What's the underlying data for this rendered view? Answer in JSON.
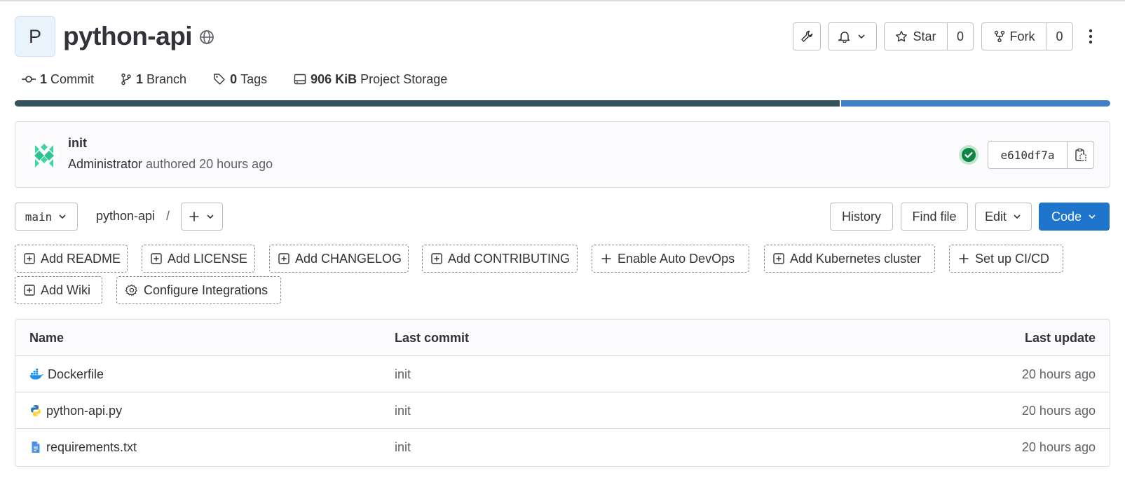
{
  "project": {
    "avatar_letter": "P",
    "name": "python-api",
    "visibility_icon": "globe-icon"
  },
  "header_actions": {
    "settings_icon": "wrench-icon",
    "notifications_icon": "bell-icon",
    "star_label": "Star",
    "star_count": "0",
    "fork_label": "Fork",
    "fork_count": "0",
    "more_icon": "kebab-vertical-icon"
  },
  "stats": {
    "commits_count": "1",
    "commits_label": "Commit",
    "branches_count": "1",
    "branches_label": "Branch",
    "tags_count": "0",
    "tags_label": "Tags",
    "storage_size": "906 KiB",
    "storage_label": "Project Storage"
  },
  "storage_usage": {
    "segments": [
      {
        "fraction": 0.753,
        "color": "#35535d"
      },
      {
        "fraction": 0.247,
        "color": "#3f7fc8"
      }
    ]
  },
  "last_commit": {
    "title": "init",
    "author": "Administrator",
    "authored_text": "authored 20 hours ago",
    "pipeline_status": "success",
    "status_color": "#108548",
    "sha": "e610df7a",
    "copy_icon": "copy-to-clipboard-icon"
  },
  "nav": {
    "branch": "main",
    "breadcrumb_root": "python-api",
    "breadcrumb_separator": "/",
    "add_icon": "plus-icon",
    "history_label": "History",
    "find_file_label": "Find file",
    "edit_label": "Edit",
    "code_label": "Code",
    "code_button_color": "#1f75cb"
  },
  "suggestions": [
    {
      "label": "Add README",
      "icon": "plus-square-icon"
    },
    {
      "label": "Add LICENSE",
      "icon": "plus-square-icon"
    },
    {
      "label": "Add CHANGELOG",
      "icon": "plus-square-icon"
    },
    {
      "label": "Add CONTRIBUTING",
      "icon": "plus-square-icon"
    },
    {
      "label": "Enable Auto DevOps",
      "icon": "plus-icon"
    },
    {
      "label": "Add Kubernetes cluster",
      "icon": "plus-square-icon"
    },
    {
      "label": "Set up CI/CD",
      "icon": "plus-icon"
    },
    {
      "label": "Add Wiki",
      "icon": "plus-square-icon"
    },
    {
      "label": "Configure Integrations",
      "icon": "settings-icon"
    }
  ],
  "files": {
    "headers": {
      "name": "Name",
      "last_commit": "Last commit",
      "last_update": "Last update"
    },
    "rows": [
      {
        "name": "Dockerfile",
        "icon": "docker-icon",
        "last_commit": "init",
        "last_update": "20 hours ago"
      },
      {
        "name": "python-api.py",
        "icon": "python-icon",
        "last_commit": "init",
        "last_update": "20 hours ago"
      },
      {
        "name": "requirements.txt",
        "icon": "text-file-icon",
        "last_commit": "init",
        "last_update": "20 hours ago"
      }
    ]
  }
}
